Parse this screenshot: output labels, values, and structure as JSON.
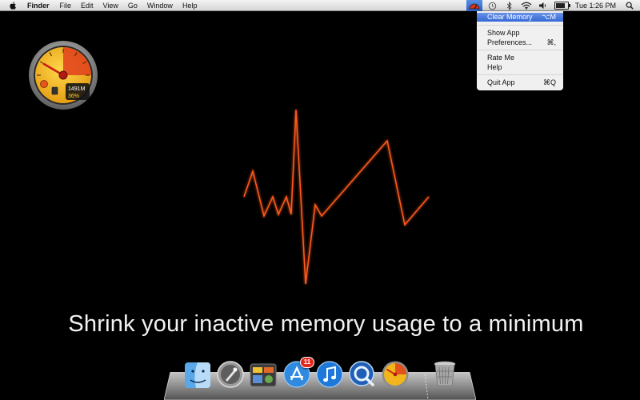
{
  "menubar": {
    "apple_icon": "apple-icon",
    "app_name": "Finder",
    "menus": [
      "File",
      "Edit",
      "View",
      "Go",
      "Window",
      "Help"
    ],
    "status_icons": [
      "memory-gauge-icon",
      "time-machine-icon",
      "bluetooth-icon",
      "wifi-icon",
      "volume-icon",
      "battery-icon"
    ],
    "clock": "Tue 1:26 PM",
    "spotlight_icon": "spotlight-search-icon"
  },
  "dropdown": {
    "items": [
      {
        "label": "Clear Memory",
        "shortcut": "⌥M",
        "highlighted": true
      },
      {
        "label": "Show App",
        "shortcut": ""
      },
      {
        "label": "Preferences...",
        "shortcut": "⌘,"
      },
      {
        "label": "Rate Me",
        "shortcut": ""
      },
      {
        "label": "Help",
        "shortcut": ""
      },
      {
        "label": "Quit App",
        "shortcut": "⌘Q"
      }
    ]
  },
  "gauge_widget": {
    "memory": "1491M",
    "percent": "36%",
    "level_fraction": 0.36,
    "colors": {
      "face": "#f2b61c",
      "needle": "#c81e12",
      "rim": "#8a8a8a"
    }
  },
  "tagline": "Shrink your inactive memory usage to a minimum",
  "dock": {
    "apps": [
      {
        "name": "finder-icon",
        "badge": ""
      },
      {
        "name": "launchpad-icon",
        "badge": ""
      },
      {
        "name": "dashboard-icon",
        "badge": ""
      },
      {
        "name": "app-store-icon",
        "badge": "11"
      },
      {
        "name": "itunes-icon",
        "badge": ""
      },
      {
        "name": "quicktime-icon",
        "badge": ""
      },
      {
        "name": "memory-clean-icon",
        "badge": ""
      },
      {
        "name": "trash-icon",
        "badge": ""
      }
    ]
  },
  "colors": {
    "pulse": "#ff5a1e",
    "menu_highlight": "#3a6ad8"
  }
}
